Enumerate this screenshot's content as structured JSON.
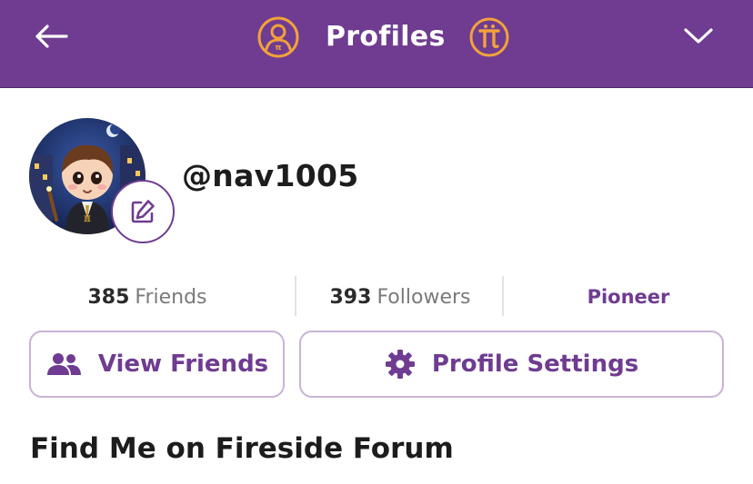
{
  "header": {
    "title": "Profiles",
    "background": "#6f3c91",
    "accent": "#f2a23b",
    "left_icon": "back-arrow-icon",
    "right_icon": "chevron-down-icon",
    "title_left_icon": "profile-user-icon",
    "title_right_icon": "pi-coin-icon"
  },
  "profile": {
    "username": "@nav1005",
    "avatar_icon": "avatar",
    "edit_icon": "edit-pencil-icon"
  },
  "stats": {
    "friends_count": "385",
    "friends_label": "Friends",
    "followers_count": "393",
    "followers_label": "Followers",
    "role": "Pioneer"
  },
  "buttons": {
    "view_friends": "View Friends",
    "profile_settings": "Profile Settings"
  },
  "section": {
    "title": "Find Me on Fireside Forum"
  }
}
